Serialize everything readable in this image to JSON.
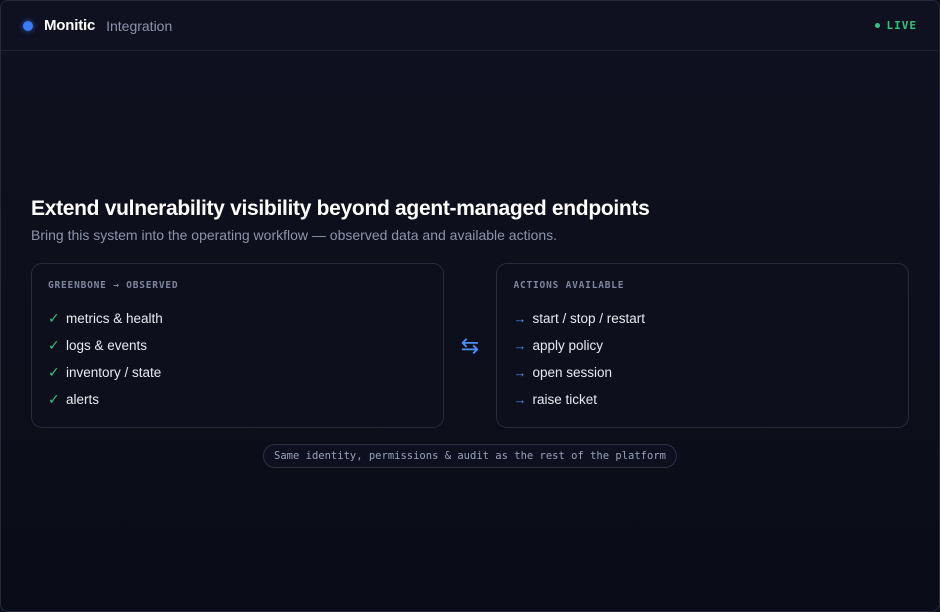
{
  "header": {
    "brand": "Monitic",
    "section": "Integration",
    "status": "LIVE"
  },
  "main": {
    "headline": "Extend vulnerability visibility beyond agent-managed endpoints",
    "subline": "Bring this system into the operating workflow — observed data and available actions.",
    "observed": {
      "title": "GREENBONE → OBSERVED",
      "items": [
        "metrics & health",
        "logs & events",
        "inventory / state",
        "alerts"
      ]
    },
    "actions": {
      "title": "ACTIONS AVAILABLE",
      "items": [
        "start / stop / restart",
        "apply policy",
        "open session",
        "raise ticket"
      ]
    },
    "footer": "Same identity, permissions & audit as the rest of the platform"
  },
  "colors": {
    "accent": "#3b7cf6",
    "live": "#35c27a",
    "background": "#0b0d18"
  },
  "icons": {
    "brand": "brand-dot-icon",
    "status": "live-dot-icon",
    "observed_item": "check-icon",
    "action_item": "arrow-right-icon",
    "link": "swap-arrows-icon"
  }
}
